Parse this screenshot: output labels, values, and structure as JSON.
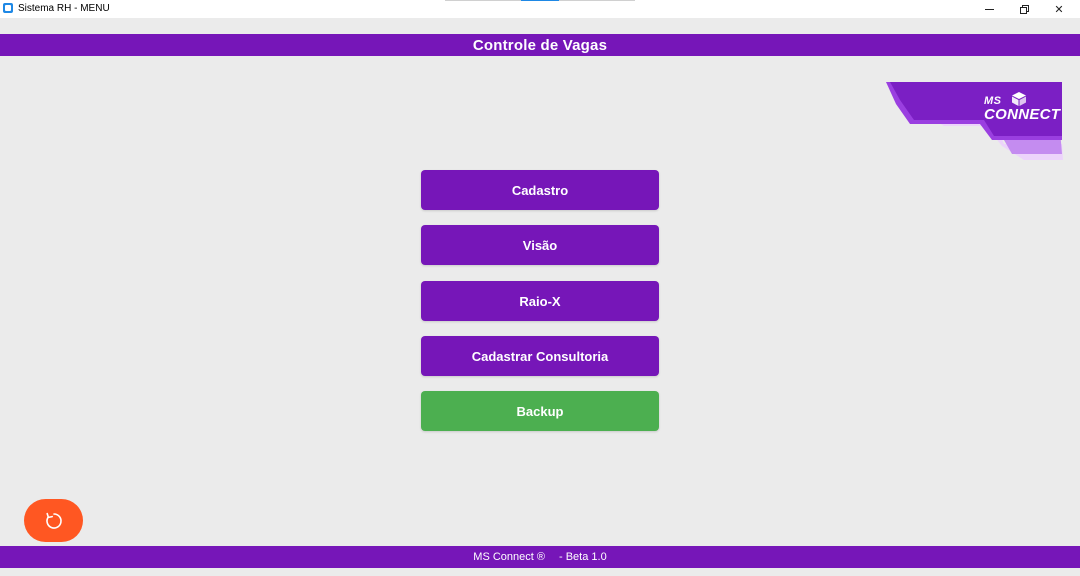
{
  "window": {
    "title": "Sistema RH - MENU",
    "controls": {
      "minimize_icon": "minimize-icon",
      "maximize_icon": "restore-icon",
      "close_label": "✕"
    }
  },
  "header": {
    "title": "Controle de Vagas"
  },
  "logo": {
    "line1": "MS",
    "line2": "CONNECT",
    "colors": [
      "#7b1fc4",
      "#9a3fe0",
      "#c48cf0",
      "#ecd3fb"
    ]
  },
  "menu": {
    "buttons": [
      {
        "label": "Cadastro",
        "color": "#7616b8"
      },
      {
        "label": "Visão",
        "color": "#7616b8"
      },
      {
        "label": "Raio-X",
        "color": "#7616b8"
      },
      {
        "label": "Cadastrar Consultoria",
        "color": "#7616b8"
      },
      {
        "label": "Backup",
        "color": "#4caf50"
      }
    ]
  },
  "refresh": {
    "icon": "refresh-icon",
    "color": "#ff5722"
  },
  "footer": {
    "brand": "MS Connect ®",
    "version": "- Beta 1.0"
  },
  "colors": {
    "accent": "#7616b8",
    "background": "#ebebeb",
    "success": "#4caf50",
    "warning": "#ff5722"
  }
}
